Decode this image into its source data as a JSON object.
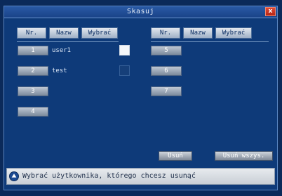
{
  "dialog": {
    "title": "Skasuj",
    "close_label": "x"
  },
  "columns": {
    "left": [
      "Nr.",
      "Nazw",
      "Wybrać"
    ],
    "right": [
      "Nr.",
      "Nazw",
      "Wybrać"
    ]
  },
  "users": [
    {
      "num": "1",
      "name": "user1",
      "selected": true
    },
    {
      "num": "2",
      "name": "test",
      "selected": false
    },
    {
      "num": "3",
      "name": ""
    },
    {
      "num": "4",
      "name": ""
    },
    {
      "num": "5",
      "name": ""
    },
    {
      "num": "6",
      "name": ""
    },
    {
      "num": "7",
      "name": ""
    }
  ],
  "actions": {
    "delete_label": "Usuń",
    "delete_all_label": "Usuń wszys."
  },
  "status": {
    "icon": "info-icon",
    "message": "Wybrać użytkownika, którego chcesz usunąć"
  },
  "colors": {
    "background": "#0e3a79",
    "close_button": "#c8321e",
    "header": "#c8d1de"
  }
}
